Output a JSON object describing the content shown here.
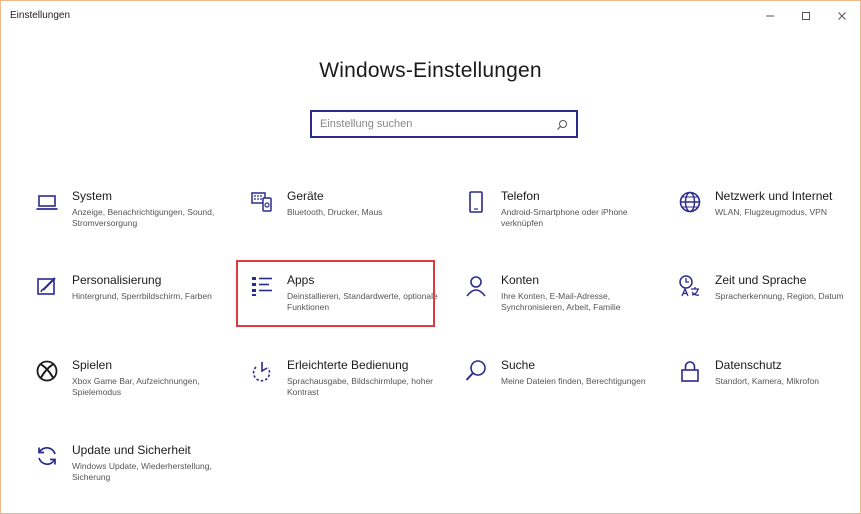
{
  "window": {
    "title": "Einstellungen",
    "controls": {
      "minimize": "minimize-icon",
      "maximize": "maximize-icon",
      "close": "close-icon"
    }
  },
  "page": {
    "title": "Windows-Einstellungen"
  },
  "search": {
    "placeholder": "Einstellung suchen",
    "value": ""
  },
  "highlight_color": "#e0393e",
  "accent_color": "#2b2b8c",
  "tiles": [
    {
      "id": "system",
      "name": "System",
      "desc": "Anzeige, Benachrichtigungen, Sound, Stromversorgung",
      "icon": "laptop-icon"
    },
    {
      "id": "geraete",
      "name": "Geräte",
      "desc": "Bluetooth, Drucker, Maus",
      "icon": "devices-icon"
    },
    {
      "id": "telefon",
      "name": "Telefon",
      "desc": "Android-Smartphone oder iPhone verknüpfen",
      "icon": "phone-icon"
    },
    {
      "id": "netzwerk",
      "name": "Netzwerk und Internet",
      "desc": "WLAN, Flugzeugmodus, VPN",
      "icon": "globe-icon"
    },
    {
      "id": "personalisierung",
      "name": "Personalisierung",
      "desc": "Hintergrund, Sperrbildschirm, Farben",
      "icon": "paint-icon"
    },
    {
      "id": "apps",
      "name": "Apps",
      "desc": "Deinstallieren, Standardwerte, optionale Funktionen",
      "icon": "apps-list-icon",
      "highlighted": true
    },
    {
      "id": "konten",
      "name": "Konten",
      "desc": "Ihre Konten, E-Mail-Adresse, Synchronisieren, Arbeit, Familie",
      "icon": "person-icon"
    },
    {
      "id": "zeit",
      "name": "Zeit und Sprache",
      "desc": "Spracherkennung, Region, Datum",
      "icon": "time-language-icon"
    },
    {
      "id": "spielen",
      "name": "Spielen",
      "desc": "Xbox Game Bar, Aufzeichnungen, Spielemodus",
      "icon": "xbox-icon"
    },
    {
      "id": "erleichtert",
      "name": "Erleichterte Bedienung",
      "desc": "Sprachausgabe, Bildschirmlupe, hoher Kontrast",
      "icon": "accessibility-icon"
    },
    {
      "id": "suche",
      "name": "Suche",
      "desc": "Meine Dateien finden, Berechtigungen",
      "icon": "magnifier-icon"
    },
    {
      "id": "datenschutz",
      "name": "Datenschutz",
      "desc": "Standort, Kamera, Mikrofon",
      "icon": "lock-icon"
    },
    {
      "id": "update",
      "name": "Update und Sicherheit",
      "desc": "Windows Update, Wiederherstellung, Sicherung",
      "icon": "sync-icon"
    }
  ]
}
